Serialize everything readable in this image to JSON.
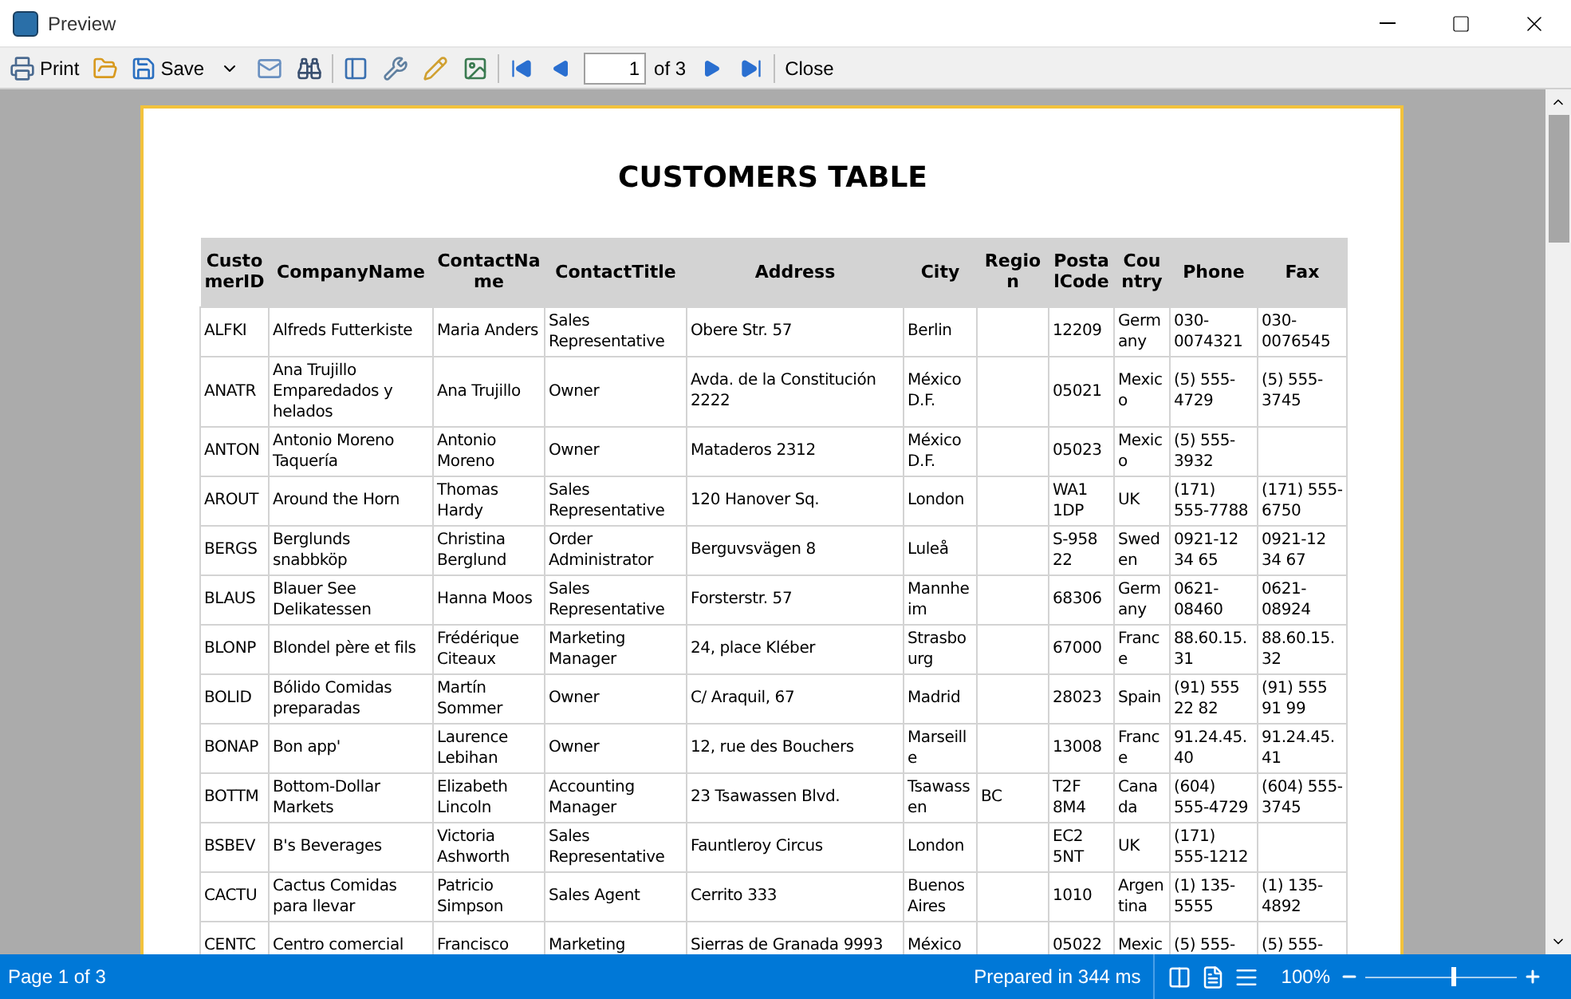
{
  "window": {
    "title": "Preview"
  },
  "toolbar": {
    "print": "Print",
    "save": "Save",
    "page_field": {
      "value": "1"
    },
    "page_total": "of 3",
    "close": "Close"
  },
  "report": {
    "title": "CUSTOMERS TABLE",
    "columns": [
      "CustomerID",
      "CompanyName",
      "ContactName",
      "ContactTitle",
      "Address",
      "City",
      "Region",
      "PostalCode",
      "Country",
      "Phone",
      "Fax"
    ],
    "rows": [
      [
        "ALFKI",
        "Alfreds Futterkiste",
        "Maria Anders",
        "Sales Representative",
        "Obere Str. 57",
        "Berlin",
        "",
        "12209",
        "Germany",
        "030-0074321",
        "030-0076545"
      ],
      [
        "ANATR",
        "Ana Trujillo Emparedados y helados",
        "Ana Trujillo",
        "Owner",
        "Avda. de la Constitución 2222",
        "México D.F.",
        "",
        "05021",
        "Mexico",
        "(5) 555-4729",
        "(5) 555-3745"
      ],
      [
        "ANTON",
        "Antonio Moreno Taquería",
        "Antonio Moreno",
        "Owner",
        "Mataderos  2312",
        "México D.F.",
        "",
        "05023",
        "Mexico",
        "(5) 555-3932",
        ""
      ],
      [
        "AROUT",
        "Around the Horn",
        "Thomas Hardy",
        "Sales Representative",
        "120 Hanover Sq.",
        "London",
        "",
        "WA1 1DP",
        "UK",
        "(171) 555-7788",
        "(171) 555-6750"
      ],
      [
        "BERGS",
        "Berglunds snabbköp",
        "Christina Berglund",
        "Order Administrator",
        "Berguvsvägen  8",
        "Luleå",
        "",
        "S-958 22",
        "Sweden",
        "0921-12 34 65",
        "0921-12 34 67"
      ],
      [
        "BLAUS",
        "Blauer See Delikatessen",
        "Hanna Moos",
        "Sales Representative",
        "Forsterstr. 57",
        "Mannheim",
        "",
        "68306",
        "Germany",
        "0621-08460",
        "0621-08924"
      ],
      [
        "BLONP",
        "Blondel père et fils",
        "Frédérique Citeaux",
        "Marketing Manager",
        "24, place Kléber",
        "Strasbourg",
        "",
        "67000",
        "France",
        "88.60.15.31",
        "88.60.15.32"
      ],
      [
        "BOLID",
        "Bólido Comidas preparadas",
        "Martín Sommer",
        "Owner",
        "C/ Araquil, 67",
        "Madrid",
        "",
        "28023",
        "Spain",
        "(91) 555 22 82",
        "(91) 555 91 99"
      ],
      [
        "BONAP",
        "Bon app'",
        "Laurence Lebihan",
        "Owner",
        "12, rue des Bouchers",
        "Marseille",
        "",
        "13008",
        "France",
        "91.24.45.40",
        "91.24.45.41"
      ],
      [
        "BOTTM",
        "Bottom-Dollar Markets",
        "Elizabeth Lincoln",
        "Accounting Manager",
        "23 Tsawassen Blvd.",
        "Tsawassen",
        "BC",
        "T2F 8M4",
        "Canada",
        "(604) 555-4729",
        "(604) 555-3745"
      ],
      [
        "BSBEV",
        "B's Beverages",
        "Victoria Ashworth",
        "Sales Representative",
        "Fauntleroy Circus",
        "London",
        "",
        "EC2 5NT",
        "UK",
        "(171) 555-1212",
        ""
      ],
      [
        "CACTU",
        "Cactus Comidas para llevar",
        "Patricio Simpson",
        "Sales Agent",
        "Cerrito 333",
        "Buenos Aires",
        "",
        "1010",
        "Argentina",
        "(1) 135-5555",
        "(1) 135-4892"
      ],
      [
        "CENTC",
        "Centro comercial",
        "Francisco",
        "Marketing",
        "Sierras de Granada 9993",
        "México",
        "",
        "05022",
        "Mexic",
        "(5) 555-",
        "(5) 555-"
      ]
    ]
  },
  "status_bar": {
    "page": "Page 1 of 3",
    "prepared": "Prepared in 344 ms",
    "zoom": "100%",
    "zoom_slider": {
      "level": 0.58
    }
  }
}
